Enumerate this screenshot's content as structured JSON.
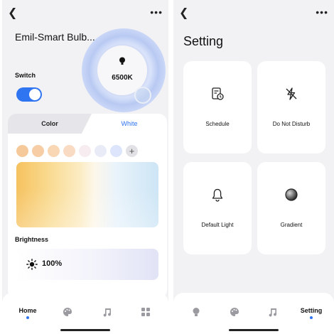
{
  "home_screen": {
    "device_name": "Emil-Smart Bulb...",
    "color_temperature": "6500K",
    "switch_label": "Switch",
    "switch_on": true,
    "tabs": {
      "color": "Color",
      "white": "White",
      "active": "White"
    },
    "swatch_colors": [
      "#f5c99a",
      "#f6cda4",
      "#f9d6b4",
      "#f9dbc4",
      "#f7ecf0",
      "#e9ecf7",
      "#dce5fb"
    ],
    "add_swatch_label": "+",
    "brightness_label": "Brightness",
    "brightness_value": "100%",
    "brightness_level": 1.0
  },
  "setting_screen": {
    "title": "Setting",
    "tiles": [
      {
        "label": "Schedule",
        "icon": "schedule-icon"
      },
      {
        "label": "Do Not Disturb",
        "icon": "do-not-disturb-icon"
      },
      {
        "label": "Default Light",
        "icon": "bell-icon"
      },
      {
        "label": "Gradient",
        "icon": "gradient-icon"
      }
    ]
  },
  "nav": {
    "home": {
      "label": "Home",
      "icons": [
        "home-bulb-icon",
        "palette-icon",
        "music-icon",
        "grid-icon"
      ]
    },
    "setting": {
      "label": "Setting",
      "icons": [
        "bulb-icon",
        "palette-icon",
        "music-icon",
        "settings-icon"
      ]
    }
  },
  "colors": {
    "accent": "#2f74f0",
    "background": "#f2f2f4",
    "card": "#ffffff"
  }
}
